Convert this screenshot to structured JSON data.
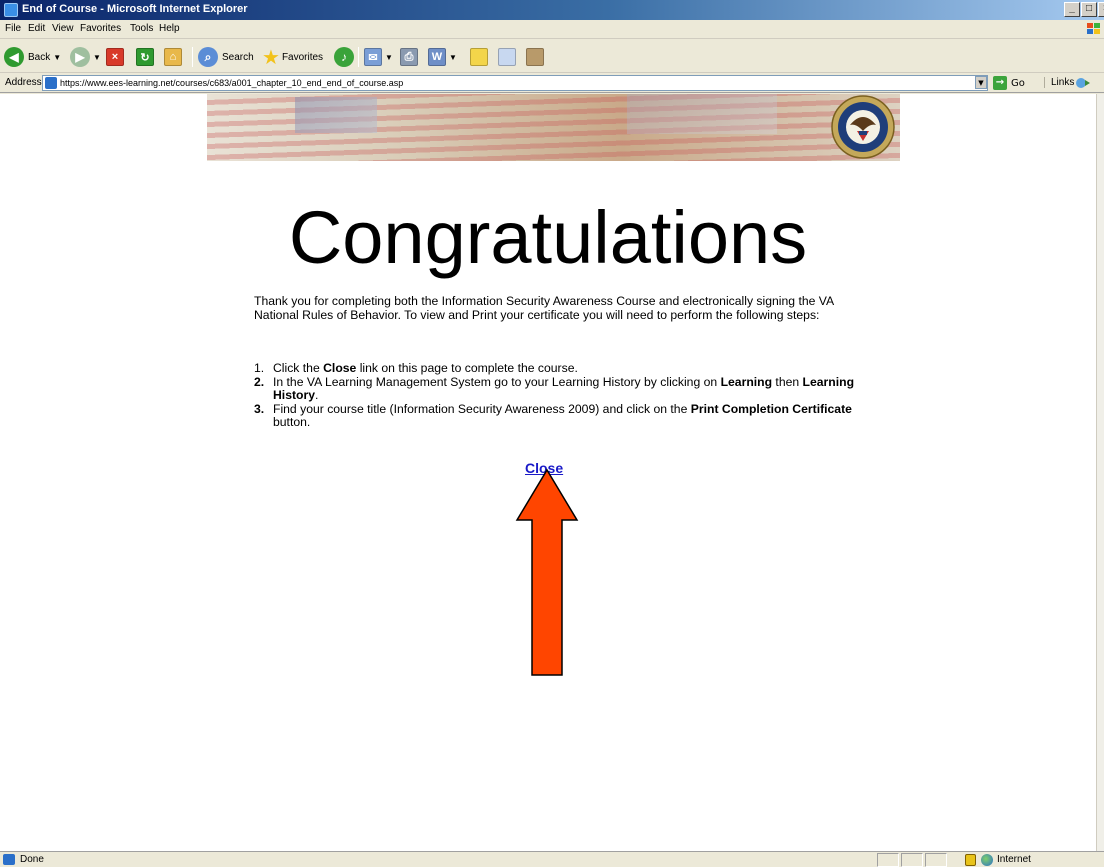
{
  "window": {
    "title": "End of Course - Microsoft Internet Explorer"
  },
  "menu": [
    "File",
    "Edit",
    "View",
    "Favorites",
    "Tools",
    "Help"
  ],
  "toolbar": {
    "back_label": "Back",
    "search_label": "Search",
    "favorites_label": "Favorites"
  },
  "address": {
    "label": "Address",
    "url": "https://www.ees-learning.net/courses/c683/a001_chapter_10_end_end_of_course.asp",
    "go_label": "Go",
    "links_label": "Links"
  },
  "page": {
    "heading": "Congratulations",
    "intro": "Thank you for completing both the Information Security Awareness Course and electronically signing the VA National Rules of Behavior.  To view and Print your certificate you will need to perform the following steps:",
    "steps": [
      {
        "num": "1.",
        "a": "Click the ",
        "b1": "Close",
        "c": " link on this page to complete the course."
      },
      {
        "num": "2.",
        "a": "In the VA Learning Management System go to your Learning History by clicking on ",
        "b1": "Learning",
        "c": " then ",
        "b2": "Learning History",
        "d": "."
      },
      {
        "num": "3.",
        "a": "Find your course title (Information Security Awareness 2009) and click on the ",
        "b1": "Print Completion Certificate",
        "c": " button."
      }
    ],
    "close_link": "Close"
  },
  "status": {
    "text": "Done",
    "zone": "Internet"
  },
  "colors": {
    "arrow_fill": "#ff4500",
    "link": "#1a1ac8",
    "title_bar": "#0a246a"
  }
}
